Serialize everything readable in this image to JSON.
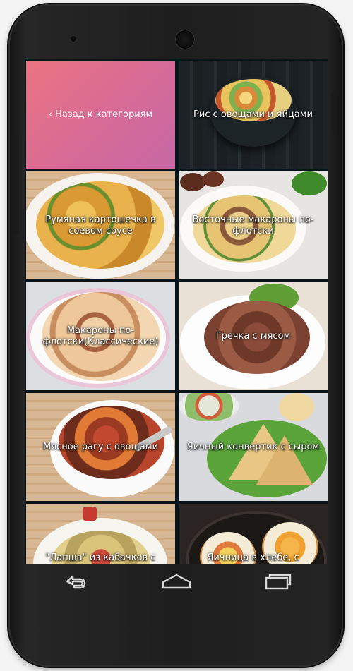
{
  "nav": {
    "back_label": "‹ Назад к категориям"
  },
  "recipes": [
    {
      "title": "Рис с овощами и яйцами"
    },
    {
      "title": "Румяная картошечка в соевом соусе"
    },
    {
      "title": "Восточные макароны по-флотски"
    },
    {
      "title": "Макароны по-флотски(Классические)"
    },
    {
      "title": "Гречка с мясом"
    },
    {
      "title": "Мясное рагу с овощами"
    },
    {
      "title": "Яичный конвертик с сыром"
    },
    {
      "title": "\"Лапша\" из кабачков с"
    },
    {
      "title": "Яичница в хлебе, с"
    }
  ],
  "system_nav": {
    "back": "back-icon",
    "home": "home-icon",
    "recents": "recents-icon"
  },
  "colors": {
    "back_tile_start": "#ec7482",
    "back_tile_end": "#c76aa6",
    "screen_bg": "#08131a"
  }
}
